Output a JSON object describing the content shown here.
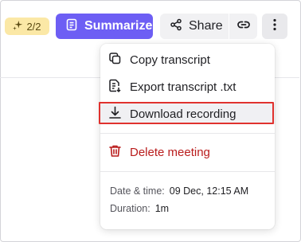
{
  "toolbar": {
    "credits": "2/2",
    "summarize_label": "Summarize",
    "share_label": "Share"
  },
  "menu": {
    "copy_transcript": "Copy transcript",
    "export_transcript": "Export transcript .txt",
    "download_recording": "Download recording",
    "delete_meeting": "Delete meeting",
    "date_label": "Date & time:",
    "date_value": "09 Dec, 12:15 AM",
    "duration_label": "Duration:",
    "duration_value": "1m"
  },
  "colors": {
    "accent": "#6d5ef4",
    "danger": "#b91c1c",
    "highlight_border": "#e0322e",
    "credits_bg": "#fbe8a6"
  },
  "icons": {
    "credits": "sparkles-icon",
    "summarize": "document-icon",
    "share": "share-icon",
    "link": "link-icon",
    "more": "more-vertical-icon",
    "copy": "copy-icon",
    "export": "export-file-icon",
    "download": "download-icon",
    "delete": "trash-icon"
  }
}
